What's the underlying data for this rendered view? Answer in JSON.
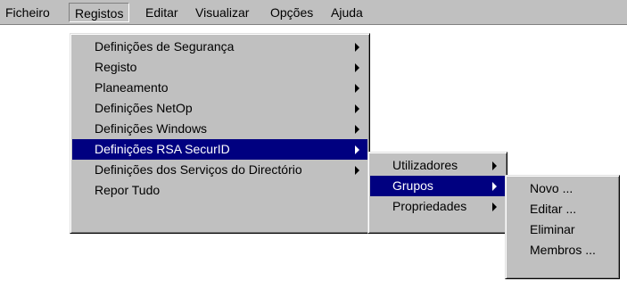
{
  "menubar": {
    "items": [
      "Ficheiro",
      "Registos",
      "Editar",
      "Visualizar",
      "Opções",
      "Ajuda"
    ]
  },
  "registos_menu": {
    "items": [
      "Definições de Segurança",
      "Registo",
      "Planeamento",
      "Definições NetOp",
      "Definições Windows",
      "Definições RSA SecurID",
      "Definições dos Serviços do Directório",
      "Repor Tudo"
    ]
  },
  "rsa_menu": {
    "items": [
      "Utilizadores",
      "Grupos",
      "Propriedades"
    ]
  },
  "grupos_menu": {
    "items": [
      "Novo ...",
      "Editar ...",
      "Eliminar",
      "Membros ..."
    ]
  },
  "colors": {
    "menu_bg": "#c0c0c0",
    "highlight": "#000080",
    "highlight_text": "#ffffff"
  },
  "icons": {
    "submenu": "submenu-arrow-icon"
  }
}
